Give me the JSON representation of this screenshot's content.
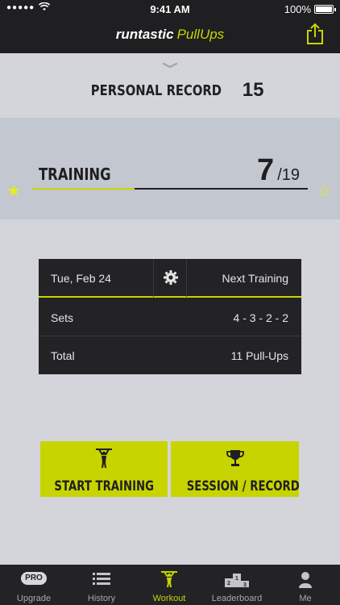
{
  "status_bar": {
    "signal": "●●●●●",
    "time": "9:41 AM",
    "battery": "100%"
  },
  "header": {
    "brand_primary": "runtastic",
    "brand_secondary": "PullUps",
    "share_icon": "share-icon"
  },
  "record": {
    "label": "PERSONAL RECORD",
    "value": "15"
  },
  "training": {
    "label": "TRAINING",
    "current": "7",
    "slash": "/",
    "total": "19",
    "progress": 0.37
  },
  "next_training": {
    "date": "Tue, Feb 24",
    "title": "Next Training",
    "sets_label": "Sets",
    "sets_value": "4 - 3 - 2 - 2",
    "total_label": "Total",
    "total_value": "11 Pull-Ups"
  },
  "actions": {
    "start_label": "START TRAINING",
    "session_label": "SESSION / RECORD"
  },
  "tabs": [
    {
      "label": "Upgrade",
      "badge": "PRO",
      "icon": "pro-badge-icon"
    },
    {
      "label": "History",
      "icon": "list-icon"
    },
    {
      "label": "Workout",
      "icon": "pullup-figure-icon",
      "active": true
    },
    {
      "label": "Leaderboard",
      "icon": "podium-icon"
    },
    {
      "label": "Me",
      "icon": "person-icon"
    }
  ],
  "colors": {
    "accent": "#c8d400",
    "dark": "#1f1f21",
    "background": "#d3d5da"
  }
}
